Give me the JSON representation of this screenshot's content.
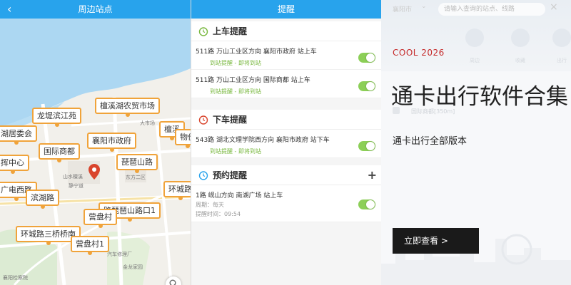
{
  "map": {
    "header_title": "周边站点",
    "back_icon": "‹",
    "stops": [
      "檀溪湖农贸市场",
      "龙堤滨江苑",
      "湖居委会",
      "襄阳市政府",
      "檀溪",
      "物价",
      "国际商都",
      "琵琶山路",
      "挥中心",
      "广电西路",
      "滨湖路",
      "环城路",
      "路琵琶山路口1",
      "营盘村",
      "环城路三桥桥南",
      "营盘村1"
    ],
    "road_labels": [
      "大市场",
      "东方二区",
      "静宁道",
      "汽车修理厂",
      "金龙家园",
      "山水檀溪",
      "襄阳检察院"
    ],
    "pin_icon": "location-pin-icon",
    "search_icon": "search-icon"
  },
  "reminders": {
    "header_title": "提醒",
    "sections": [
      {
        "title": "上车提醒",
        "icon": "alarm-clock-icon",
        "items": [
          {
            "line": "511路  万山工业区方向   襄阳市政府 站上车",
            "status": "到站提醒 - 即将到站",
            "enabled": true
          },
          {
            "line": "511路  万山工业区方向   国际商都 站上车",
            "status": "到站提醒 - 即将到站",
            "enabled": true
          }
        ]
      },
      {
        "title": "下车提醒",
        "icon": "alarm-clock-red-icon",
        "items": [
          {
            "line": "543路  湖北文理学院西方向   襄阳市政府 站下车",
            "status": "到站提醒 - 即将到站",
            "enabled": true
          }
        ]
      },
      {
        "title": "预约提醒",
        "icon": "alarm-clock-blue-icon",
        "add_icon": "+",
        "items": [
          {
            "line": "1路  岘山方向   南湖广场 站上车",
            "cycle": "周期：每天",
            "time": "提醒时间：09:54",
            "enabled": true
          }
        ]
      }
    ]
  },
  "promo": {
    "city": "襄阳市",
    "search_placeholder": "请输入查询的站点、线路",
    "close_icon": "×",
    "ghost_labels": [
      "周边",
      "收藏",
      "出行"
    ],
    "ghost_stop": "国际商都[350m]",
    "kicker": "COOL 2026",
    "title": "通卡出行软件合集",
    "subtitle": "通卡出行全部版本",
    "cta": "立即查看 >",
    "colors": {
      "kicker": "#c52a2a",
      "cta_bg": "#1a1a1a",
      "header_blue": "#28a3ec",
      "stop_border": "#f0a33a",
      "toggle_on": "#8ccf57"
    }
  }
}
